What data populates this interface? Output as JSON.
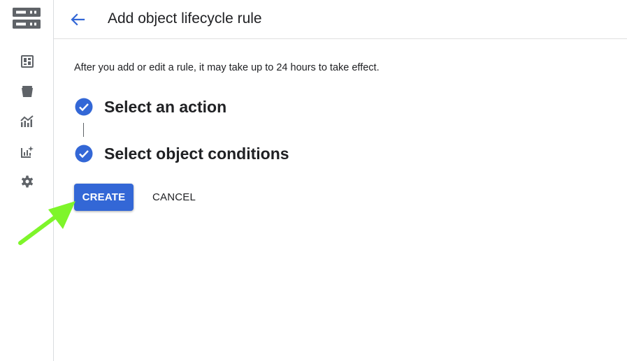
{
  "colors": {
    "accent": "#3367d6",
    "rail_icon": "#5f6368",
    "logo": "#5f6368",
    "annotation_arrow": "#7ef52a",
    "divider": "#dadce0"
  },
  "rail": {
    "logo_icon": "storage-server-icon",
    "items": [
      {
        "icon": "dashboard-icon"
      },
      {
        "icon": "bucket-icon"
      },
      {
        "icon": "monitoring-chart-icon"
      },
      {
        "icon": "insights-chart-icon"
      },
      {
        "icon": "gear-icon"
      }
    ]
  },
  "header": {
    "back_icon": "arrow-back-icon",
    "title": "Add object lifecycle rule"
  },
  "main": {
    "info_text": "After you add or edit a rule, it may take up to 24 hours to take effect.",
    "steps": [
      {
        "label": "Select an action",
        "status": "complete",
        "icon": "check-circle-icon"
      },
      {
        "label": "Select object conditions",
        "status": "complete",
        "icon": "check-circle-icon"
      }
    ],
    "actions": {
      "create_label": "CREATE",
      "cancel_label": "CANCEL"
    }
  },
  "annotation": {
    "icon": "pointer-arrow-icon",
    "target": "create-button"
  }
}
